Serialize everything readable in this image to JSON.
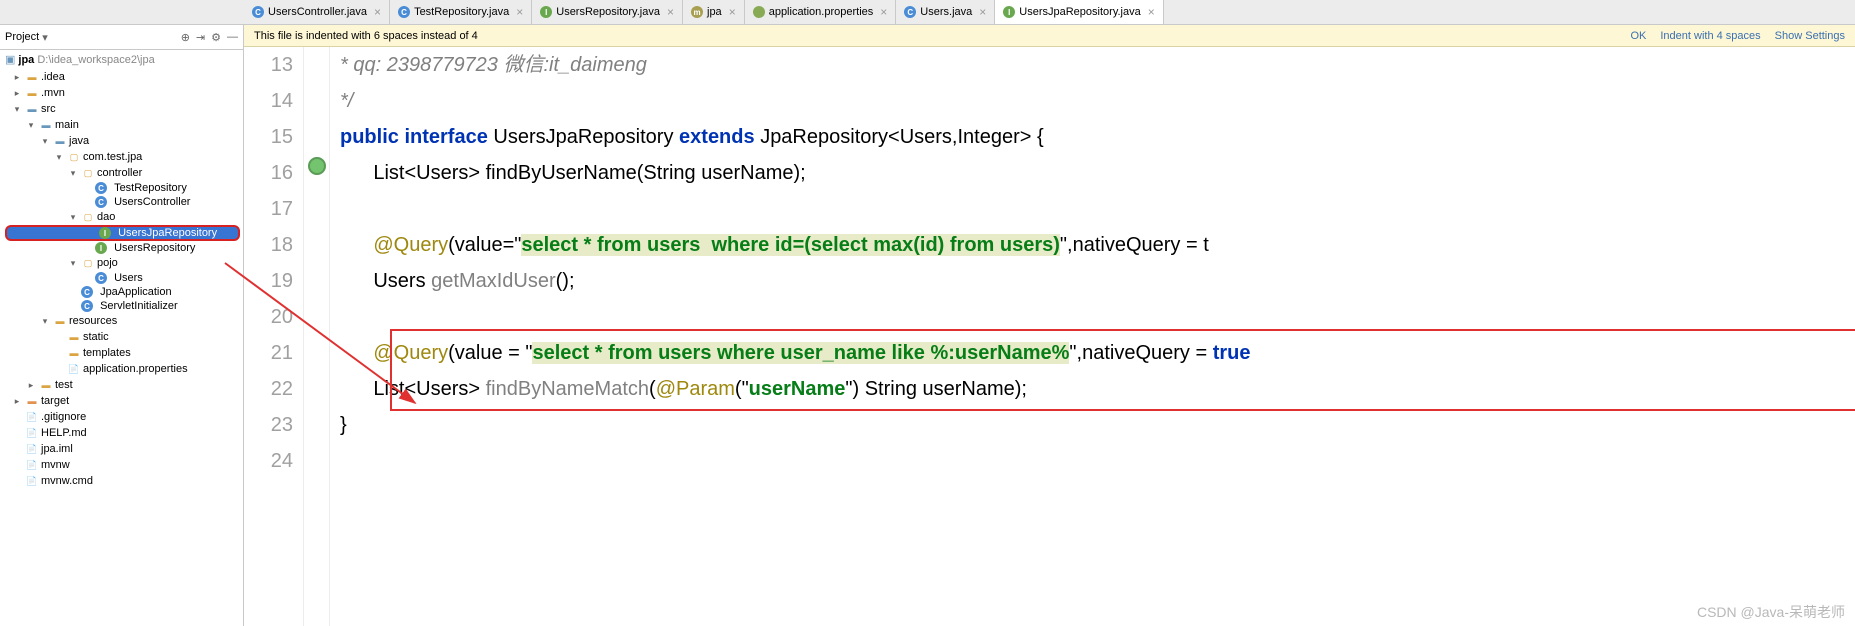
{
  "tabs": [
    {
      "icon": "C",
      "iconClass": "ic-c",
      "label": "UsersController.java",
      "active": false
    },
    {
      "icon": "C",
      "iconClass": "ic-c",
      "label": "TestRepository.java",
      "active": false
    },
    {
      "icon": "I",
      "iconClass": "ic-i",
      "label": "UsersRepository.java",
      "active": false
    },
    {
      "icon": "m",
      "iconClass": "ic-m",
      "label": "jpa",
      "active": false
    },
    {
      "icon": "",
      "iconClass": "ic-p",
      "label": "application.properties",
      "active": false
    },
    {
      "icon": "C",
      "iconClass": "ic-c",
      "label": "Users.java",
      "active": false
    },
    {
      "icon": "I",
      "iconClass": "ic-i",
      "label": "UsersJpaRepository.java",
      "active": true
    }
  ],
  "sidebar": {
    "title": "Project",
    "root": "jpa",
    "rootPath": "D:\\idea_workspace2\\jpa",
    "items": {
      "idea": ".idea",
      "mvn": ".mvn",
      "src": "src",
      "main": "main",
      "java": "java",
      "pkg": "com.test.jpa",
      "controller": "controller",
      "testRepo": "TestRepository",
      "usersCtrl": "UsersController",
      "dao": "dao",
      "usersJpaRepo": "UsersJpaRepository",
      "usersRepo": "UsersRepository",
      "pojo": "pojo",
      "users": "Users",
      "jpaApp": "JpaApplication",
      "servInit": "ServletInitializer",
      "resources": "resources",
      "static": "static",
      "templates": "templates",
      "appProps": "application.properties",
      "test": "test",
      "target": "target",
      "gitignore": ".gitignore",
      "help": "HELP.md",
      "jpaIml": "jpa.iml",
      "mvnw": "mvnw",
      "mvnwCmd": "mvnw.cmd"
    }
  },
  "banner": {
    "msg": "This file is indented with 6 spaces instead of 4",
    "ok": "OK",
    "indent": "Indent with 4 spaces",
    "show": "Show Settings"
  },
  "lines": {
    "start": 13,
    "l13": "* qq: 2398779723 微信:it_daimeng",
    "l14": "*/",
    "l15_public": "public",
    "l15_interface": "interface",
    "l15_name": "UsersJpaRepository",
    "l15_extends": "extends",
    "l15_jpa": "JpaRepository<Users,Integer> {",
    "l16": "      List<Users> findByUserName(String userName);",
    "l18_ann": "@Query",
    "l18_val": "(value=\"",
    "l18_sql": "select * from users  where id=(select max(id) from users)",
    "l18_end": "\",nativeQuery = t",
    "l19_a": "Users ",
    "l19_m": "getMaxIdUser",
    "l19_b": "();",
    "l21_ann": "@Query",
    "l21_a": "(value = \"",
    "l21_sql": "select * from users where user_name like %:userName%",
    "l21_b": "\",nativeQuery = ",
    "l21_true": "true",
    "l22_a": "List<Users> ",
    "l22_m": "findByNameMatch",
    "l22_b": "(",
    "l22_ann": "@Param",
    "l22_c": "(\"",
    "l22_p": "userName",
    "l22_d": "\") String userName);",
    "l23": "}"
  },
  "watermark": "CSDN @Java-呆萌老师"
}
